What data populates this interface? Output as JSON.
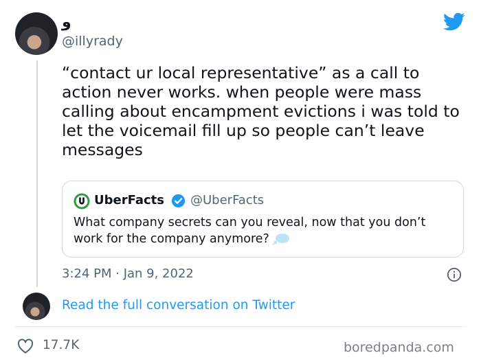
{
  "tweet": {
    "display_name": "و",
    "handle": "@illyrady",
    "text": "“contact ur local representative” as a call to action never works. when people were mass calling about encampment evictions i was told to let the voicemail fill up so people can’t leave messages",
    "timestamp": "3:24 PM · Jan 9, 2022",
    "brand_color": "#1d9bf0"
  },
  "quote": {
    "name": "UberFacts",
    "handle": "@UberFacts",
    "text": "What company secrets can you reveal, now that you don’t work for the company anymore?",
    "logo_color": "#2e9b3e"
  },
  "footer": {
    "read_link": "Read the full conversation on Twitter",
    "likes": "17.7K",
    "watermark": "boredpanda.com"
  },
  "icons": [
    "twitter-bird-icon",
    "verified-badge-icon",
    "thought-bubble-icon",
    "info-icon",
    "heart-icon"
  ]
}
